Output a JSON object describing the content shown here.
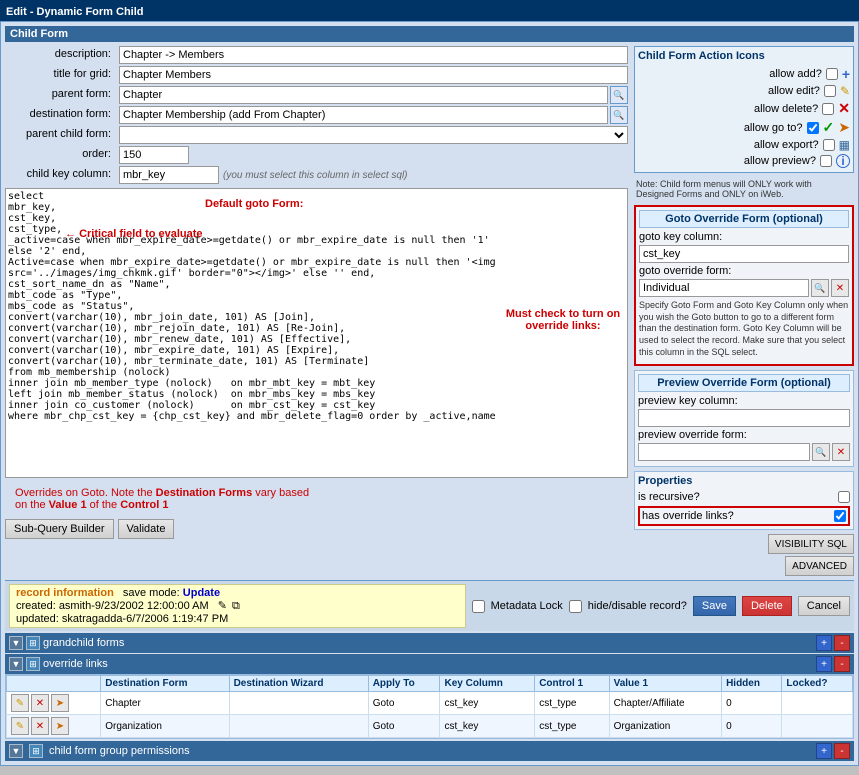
{
  "window": {
    "title": "Edit - Dynamic Form Child"
  },
  "child_form_section": "Child Form",
  "form_fields": {
    "description_label": "description:",
    "description_value": "Chapter -> Members",
    "title_for_grid_label": "title for grid:",
    "title_for_grid_value": "Chapter Members",
    "parent_form_label": "parent form:",
    "parent_form_value": "Chapter",
    "destination_form_label": "destination form:",
    "destination_form_value": "Chapter Membership (add From Chapter)",
    "parent_child_form_label": "parent child form:",
    "order_label": "order:",
    "order_value": "150",
    "child_key_column_label": "child key column:",
    "child_key_column_value": "mbr_key",
    "child_key_hint": "(you must select this column in select sql)"
  },
  "right_panel": {
    "child_form_action_label": "Child Form Action -",
    "child_form_action_icons_title": "Child Form Action Icons",
    "allow_add_label": "allow add?",
    "allow_edit_label": "allow edit?",
    "allow_delete_label": "allow delete?",
    "allow_goto_label": "allow go to?",
    "allow_export_label": "allow export?",
    "allow_preview_label": "allow preview?",
    "note_text": "Note: Child form menus will ONLY work with Designed Forms and ONLY on iWeb.",
    "goto_override_title": "Goto Override Form (optional)",
    "goto_key_column_label": "goto key column:",
    "goto_key_column_value": "cst_key",
    "goto_override_form_label": "goto override form:",
    "goto_override_form_value": "Individual",
    "goto_description": "Specify Goto Form and Goto Key Column only when you wish the Goto button to go to a different form than the destination form. Goto Key Column will be used to select the record. Make sure that you select this column in the SQL select.",
    "preview_override_title": "Preview Override Form (optional)",
    "preview_key_column_label": "preview key column:",
    "preview_key_column_value": "",
    "preview_override_form_label": "preview override form:",
    "preview_override_form_value": "",
    "properties_title": "Properties",
    "is_recursive_label": "is recursive?",
    "has_override_links_label": "has override links?",
    "visibility_sql_btn": "VISIBILITY SQL",
    "advanced_btn": "ADVANCED"
  },
  "sql_content": "select\nmbr_key,\ncst_key,\ncst_type,\n_active=case when mbr_expire_date>=getdate() or mbr_expire_date is null then '1'\nelse '2' end,\nActive=case when mbr_expire_date>=getdate() or mbr_expire_date is null then '<img\nsrc='../images/img_chkmk.gif' border=\"0\"></img>' else '' end,\ncst_sort_name_dn as \"Name\",\nmbt_code as \"Type\",\nmbs_code as \"Status\",\nconvert(varchar(10), mbr_join_date, 101) AS [Join],\nconvert(varchar(10), mbr_rejoin_date, 101) AS [Re-Join],\nconvert(varchar(10), mbr_renew_date, 101) AS [Effective],\nconvert(varchar(10), mbr_expire_date, 101) AS [Expire],\nconvert(varchar(10), mbr_terminate_date, 101) AS [Terminate]\nfrom mb_membership (nolock)\ninner join mb_member_type (nolock)   on mbr_mbt_key = mbt_key\nleft join mb_member_status (nolock)  on mbr_mbs_key = mbs_key\ninner join co_customer (nolock)      on mbr_cst_key = cst_key\nwhere mbr_chp_cst_key = {chp_cst_key} and mbr_delete_flag=0 order by _active,name",
  "annotations": {
    "critical_field": "Critical field to evaluate",
    "default_goto": "Default goto Form:",
    "must_check": "Must check to turn\non override links:",
    "overrides_note": "Overrides on Goto. Note the Destination Forms vary based\non the Value 1 of the Control 1"
  },
  "bottom_bar": {
    "record_info_label": "record information",
    "save_mode_label": "save mode:",
    "save_mode_value": "Update",
    "created_label": "created:",
    "created_value": "asmith-9/23/2002 12:00:00 AM",
    "updated_label": "updated:",
    "updated_value": "skatragadda-6/7/2006 1:19:47 PM",
    "metadata_lock_label": "Metadata Lock",
    "hide_disable_label": "hide/disable record?",
    "save_btn": "Save",
    "delete_btn": "Delete",
    "cancel_btn": "Cancel"
  },
  "grandchild_section": {
    "label": "grandchild forms"
  },
  "override_links_section": {
    "label": "override links",
    "columns": [
      "Destination Form",
      "Destination Wizard",
      "Apply To",
      "Key Column",
      "Control 1",
      "Value 1",
      "Hidden",
      "Locked?"
    ],
    "rows": [
      {
        "destination_form": "Chapter",
        "destination_wizard": "",
        "apply_to": "Goto",
        "key_column": "cst_key",
        "control_1": "cst_type",
        "value_1": "Chapter/Affiliate",
        "hidden": "0",
        "locked": ""
      },
      {
        "destination_form": "Organization",
        "destination_wizard": "",
        "apply_to": "Goto",
        "key_column": "cst_key",
        "control_1": "cst_type",
        "value_1": "Organization",
        "hidden": "0",
        "locked": ""
      }
    ]
  },
  "child_form_permissions": {
    "label": "child form group permissions"
  },
  "icons": {
    "plus": "+",
    "pencil": "✎",
    "x_red": "✕",
    "check_green": "✓",
    "chart": "▦",
    "info": "i",
    "search": "🔍",
    "expand": "▼",
    "collapse": "▲",
    "arrow_right": "→"
  }
}
